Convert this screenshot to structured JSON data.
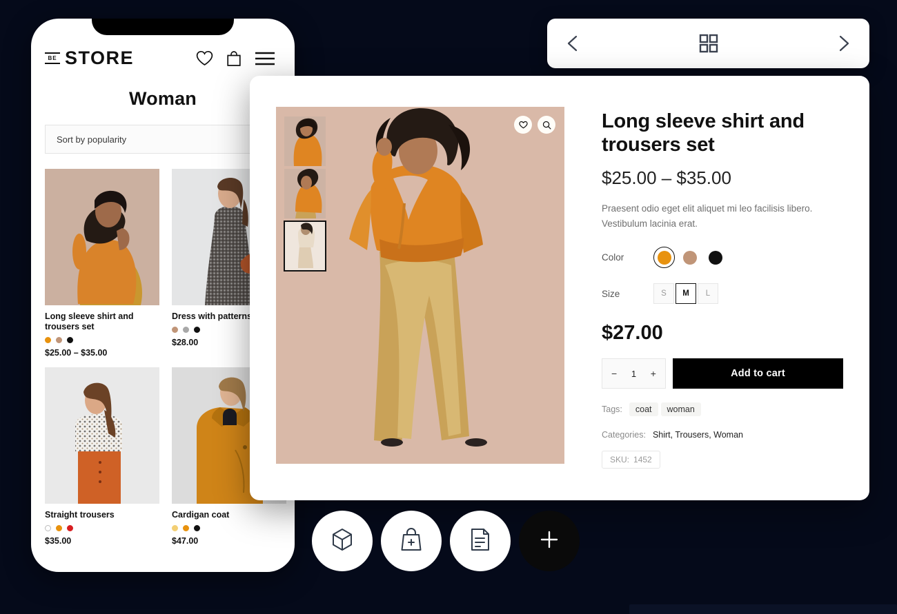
{
  "theme": {
    "background": "#050a1a",
    "accent_orange": "#E8920E",
    "accent_tan": "#C09578",
    "accent_black": "#111111",
    "panel_white": "#FFFFFF"
  },
  "topnav": {
    "prev_label": "Previous",
    "grid_label": "Grid view",
    "next_label": "Next",
    "icons": [
      "chevron-left-icon",
      "grid-icon",
      "chevron-right-icon"
    ]
  },
  "phone": {
    "logo": {
      "badge": "BE",
      "word": "STORE"
    },
    "header_icons": [
      "heart-icon",
      "bag-icon",
      "menu-icon"
    ],
    "page_title": "Woman",
    "sort": {
      "value": "Sort by popularity",
      "placeholder": "Sort by popularity"
    },
    "products": [
      {
        "name": "Long sleeve shirt and trousers set",
        "price": "$25.00 – $35.00",
        "swatches": [
          "#E8920E",
          "#C09578",
          "#111111"
        ],
        "image": "woman-orange-satin-shirt"
      },
      {
        "name": "Dress with patterns",
        "price": "$28.00",
        "swatches": [
          "#C09578",
          "#A8A8A8",
          "#111111"
        ],
        "image": "woman-patterned-dress"
      },
      {
        "name": "Straight trousers",
        "price": "$35.00",
        "swatches": [
          "#FFFFFF",
          "#E8920E",
          "#D81E21"
        ],
        "image": "woman-straight-trousers"
      },
      {
        "name": "Cardigan coat",
        "price": "$47.00",
        "swatches": [
          "#F3CF74",
          "#E8920E",
          "#111111"
        ],
        "image": "woman-cardigan-coat"
      }
    ]
  },
  "detail": {
    "gallery": {
      "thumbnails": [
        {
          "name": "thumb-orange-shirt-1",
          "active": false
        },
        {
          "name": "thumb-orange-shirt-2",
          "active": false
        },
        {
          "name": "thumb-beige-set-3",
          "active": true
        }
      ],
      "actions": [
        {
          "icon": "heart-icon",
          "label": "Add to wishlist"
        },
        {
          "icon": "search-icon",
          "label": "Zoom image"
        }
      ],
      "main_image": "woman-orange-shirt-gold-trousers"
    },
    "title": "Long sleeve shirt and trousers set",
    "price_range": "$25.00 – $35.00",
    "description": "Praesent odio eget elit aliquet mi leo facilisis libero. Vestibulum lacinia erat.",
    "color": {
      "label": "Color",
      "options": [
        {
          "name": "orange",
          "hex": "#E8920E",
          "selected": true
        },
        {
          "name": "tan",
          "hex": "#C09578",
          "selected": false
        },
        {
          "name": "black",
          "hex": "#111111",
          "selected": false
        }
      ]
    },
    "size": {
      "label": "Size",
      "options": [
        {
          "label": "S",
          "selected": false
        },
        {
          "label": "M",
          "selected": true
        },
        {
          "label": "L",
          "selected": false
        }
      ]
    },
    "selected_price": "$27.00",
    "quantity": {
      "minus": "−",
      "value": "1",
      "plus": "+"
    },
    "add_to_cart": "Add to cart",
    "tags": {
      "label": "Tags:",
      "items": [
        "coat",
        "woman"
      ]
    },
    "categories": {
      "label": "Categories:",
      "value": "Shirt, Trousers, Woman"
    },
    "sku": {
      "label": "SKU:",
      "value": "1452"
    }
  },
  "fabs": [
    {
      "icon": "cube-icon",
      "label": "Products",
      "dark": false
    },
    {
      "icon": "bag-plus-icon",
      "label": "Add to bag",
      "dark": false
    },
    {
      "icon": "document-icon",
      "label": "Orders",
      "dark": false
    },
    {
      "icon": "plus-icon",
      "label": "Add new",
      "dark": true
    }
  ]
}
